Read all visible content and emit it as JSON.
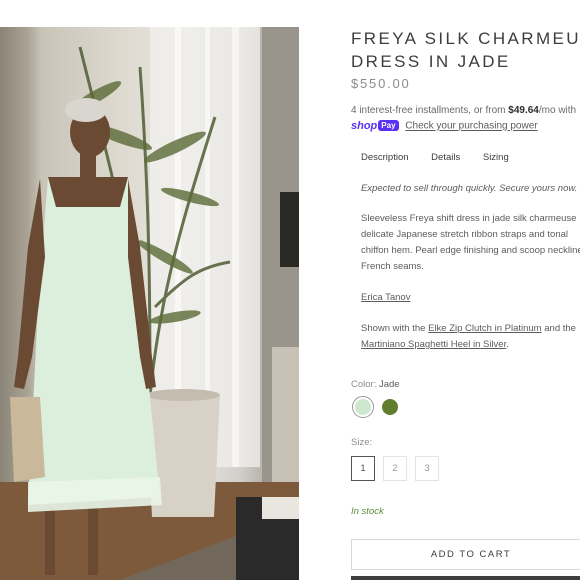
{
  "product": {
    "title_line1": "FREYA SILK CHARMEUSE",
    "title_line2": "DRESS IN JADE",
    "price": "$550.00"
  },
  "installments": {
    "text_before": "4 interest-free installments, or from ",
    "amount": "$49.64",
    "text_after": "/mo with",
    "shop_label": "shop",
    "pay_label": "Pay",
    "check_link": "Check your purchasing power"
  },
  "tabs": [
    "Description",
    "Details",
    "Sizing"
  ],
  "description": {
    "emphasis": "Expected to sell through quickly. Secure yours now.",
    "body_lines": [
      "Sleeveless Freya shift dress in jade silk charmeuse",
      "delicate Japanese stretch ribbon straps and tonal",
      "chiffon hem. Pearl edge finishing and scoop neckline",
      "French seams."
    ],
    "designer": "Erica Tanov",
    "shown_prefix": "Shown with the ",
    "shown_link1": "Elke Zip Clutch in Platinum",
    "shown_mid": " and the",
    "shown_link2": "Martiniano Spaghetti Heel in Silver",
    "shown_suffix": "."
  },
  "color": {
    "label": "Color:",
    "selected": "Jade",
    "swatches": [
      {
        "name": "Jade",
        "hex": "#cde8cf",
        "selected": true
      },
      {
        "name": "Olive",
        "hex": "#5f7f2e",
        "selected": false
      }
    ]
  },
  "size": {
    "label": "Size:",
    "options": [
      "1",
      "2",
      "3"
    ],
    "selected": "1"
  },
  "stock_status": "In stock",
  "add_to_cart": "ADD TO CART",
  "colors": {
    "stock_green": "#5a8a3c",
    "shop_pay_purple": "#5a31f4",
    "text_dark": "#3d3d3d"
  }
}
